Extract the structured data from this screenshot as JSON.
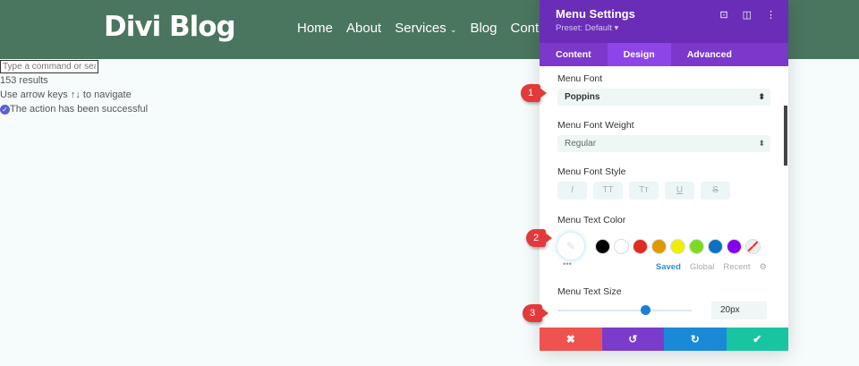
{
  "site": {
    "logo": "Divi Blog",
    "nav": [
      "Home",
      "About",
      "Services",
      "Blog",
      "Cont"
    ]
  },
  "command": {
    "placeholder": "Type a command or search",
    "results": "153 results",
    "hint": "Use arrow keys ↑↓ to navigate",
    "success": "The action has been successful"
  },
  "panel": {
    "title": "Menu Settings",
    "preset": "Preset: Default ▾",
    "tabs": [
      "Content",
      "Design",
      "Advanced"
    ],
    "font_label": "Menu Font",
    "font_value": "Poppins",
    "weight_label": "Menu Font Weight",
    "weight_value": "Regular",
    "style_label": "Menu Font Style",
    "styles": [
      "I",
      "TT",
      "Tт",
      "U",
      "S"
    ],
    "color_label": "Menu Text Color",
    "swatches": [
      "#000000",
      "#ffffff",
      "#e02b20",
      "#e09900",
      "#edf000",
      "#7cda24",
      "#0c71c3",
      "#8300e9"
    ],
    "color_tabs": [
      "Saved",
      "Global",
      "Recent"
    ],
    "dots": "•••",
    "size_label": "Menu Text Size",
    "size_value": "20px",
    "size_slider_fraction": 0.65,
    "footer": {
      "cancel": "✖",
      "undo": "↺",
      "redo": "↻",
      "save": "✔"
    }
  },
  "badges": [
    "1",
    "2",
    "3"
  ]
}
